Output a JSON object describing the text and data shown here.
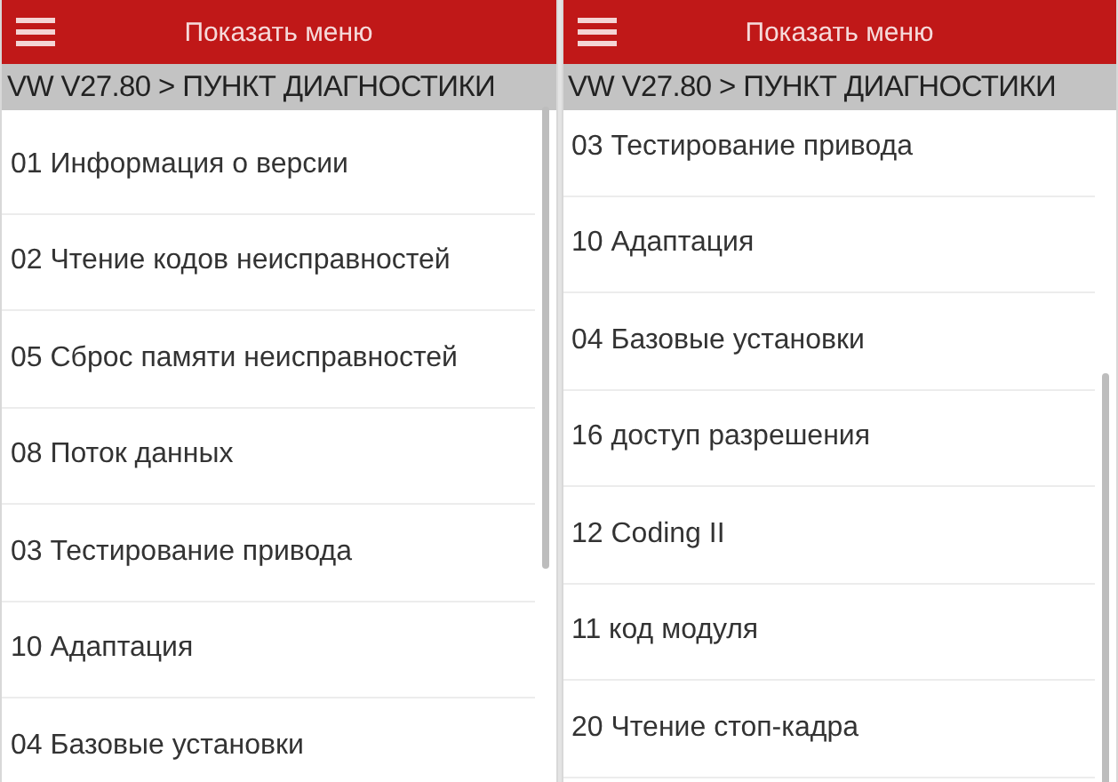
{
  "panels": [
    {
      "header": {
        "title": "Показать меню"
      },
      "breadcrumb": "VW V27.80 > ПУНКТ ДИАГНОСТИКИ",
      "scrolled": false,
      "items": [
        {
          "label": "01 Информация о версии"
        },
        {
          "label": "02 Чтение кодов неисправностей"
        },
        {
          "label": "05 Сброс памяти неисправностей"
        },
        {
          "label": "08 Поток данных"
        },
        {
          "label": "03 Тестирование привода"
        },
        {
          "label": "10 Адаптация"
        },
        {
          "label": "04 Базовые установки"
        }
      ]
    },
    {
      "header": {
        "title": "Показать меню"
      },
      "breadcrumb": "VW V27.80 > ПУНКТ ДИАГНОСТИКИ",
      "scrolled": true,
      "items": [
        {
          "label": "03 Тестирование привода"
        },
        {
          "label": "10 Адаптация"
        },
        {
          "label": "04 Базовые установки"
        },
        {
          "label": "16 доступ разрешения"
        },
        {
          "label": "12 Coding II"
        },
        {
          "label": "11 код модуля"
        },
        {
          "label": "20 Чтение стоп-кадра"
        }
      ]
    }
  ]
}
